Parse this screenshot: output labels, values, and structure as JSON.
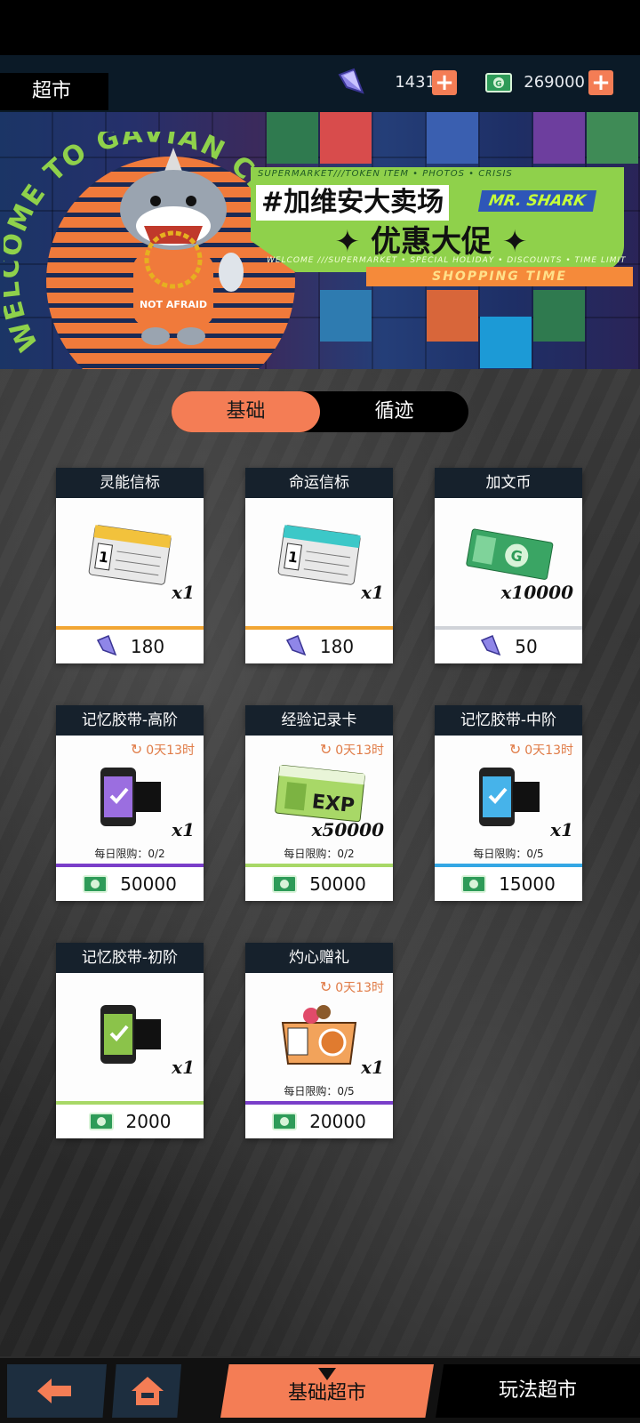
{
  "header": {
    "title": "超市",
    "currency_crystal": "1431",
    "currency_cash": "269000",
    "plus_label": "+"
  },
  "banner": {
    "welcome": "WELCOME TO GAVIAN CITY",
    "panel_top": "SUPERMARKET///TOKEN ITEM • PHOTOS • CRISIS",
    "hashtag_title": "#加维安大卖场",
    "mr_shark": "MR. SHARK",
    "promo": "优惠大促",
    "panel_bottom": "WELCOME ///SUPERMARKET • SPECIAL HOLIDAY • DISCOUNTS • TIME LIMIT",
    "shopping_time": "SHOPPING  TIME",
    "shirt_text": "NOT AFRAID"
  },
  "tabs": [
    {
      "label": "基础",
      "active": true
    },
    {
      "label": "循迹",
      "active": false
    }
  ],
  "items": [
    {
      "name": "灵能信标",
      "qty": "x1",
      "price": "180",
      "currency": "crystal",
      "stripe": "#f2a634",
      "timer": "",
      "limit": "",
      "icon": "ticket-yellow-icon"
    },
    {
      "name": "命运信标",
      "qty": "x1",
      "price": "180",
      "currency": "crystal",
      "stripe": "#f2a634",
      "timer": "",
      "limit": "",
      "icon": "ticket-cyan-icon"
    },
    {
      "name": "加文币",
      "qty": "x10000",
      "price": "50",
      "currency": "crystal",
      "stripe": "#d0d3d8",
      "timer": "",
      "limit": "",
      "icon": "coin-bill-icon"
    },
    {
      "name": "记忆胶带-高阶",
      "qty": "x1",
      "price": "50000",
      "currency": "cash",
      "stripe": "#7a3ec9",
      "timer": "0天13时",
      "limit": "每日限购：0/2",
      "icon": "memory-tape-purple-icon"
    },
    {
      "name": "经验记录卡",
      "qty": "x50000",
      "price": "50000",
      "currency": "cash",
      "stripe": "#a8d867",
      "timer": "0天13时",
      "limit": "每日限购：0/2",
      "icon": "exp-card-icon"
    },
    {
      "name": "记忆胶带-中阶",
      "qty": "x1",
      "price": "15000",
      "currency": "cash",
      "stripe": "#34a7e4",
      "timer": "0天13时",
      "limit": "每日限购：0/5",
      "icon": "memory-tape-blue-icon"
    },
    {
      "name": "记忆胶带-初阶",
      "qty": "x1",
      "price": "2000",
      "currency": "cash",
      "stripe": "#a8d867",
      "timer": "",
      "limit": "",
      "icon": "memory-tape-green-icon"
    },
    {
      "name": "灼心赠礼",
      "qty": "x1",
      "price": "20000",
      "currency": "cash",
      "stripe": "#7a3ec9",
      "timer": "0天13时",
      "limit": "每日限购：0/5",
      "icon": "gift-box-icon"
    }
  ],
  "bottom_nav": {
    "basic_market": "基础超市",
    "play_market": "玩法超市"
  },
  "colors": {
    "accent": "#f47d55",
    "header_bg": "#0b1a27",
    "card_head": "#16212c"
  }
}
